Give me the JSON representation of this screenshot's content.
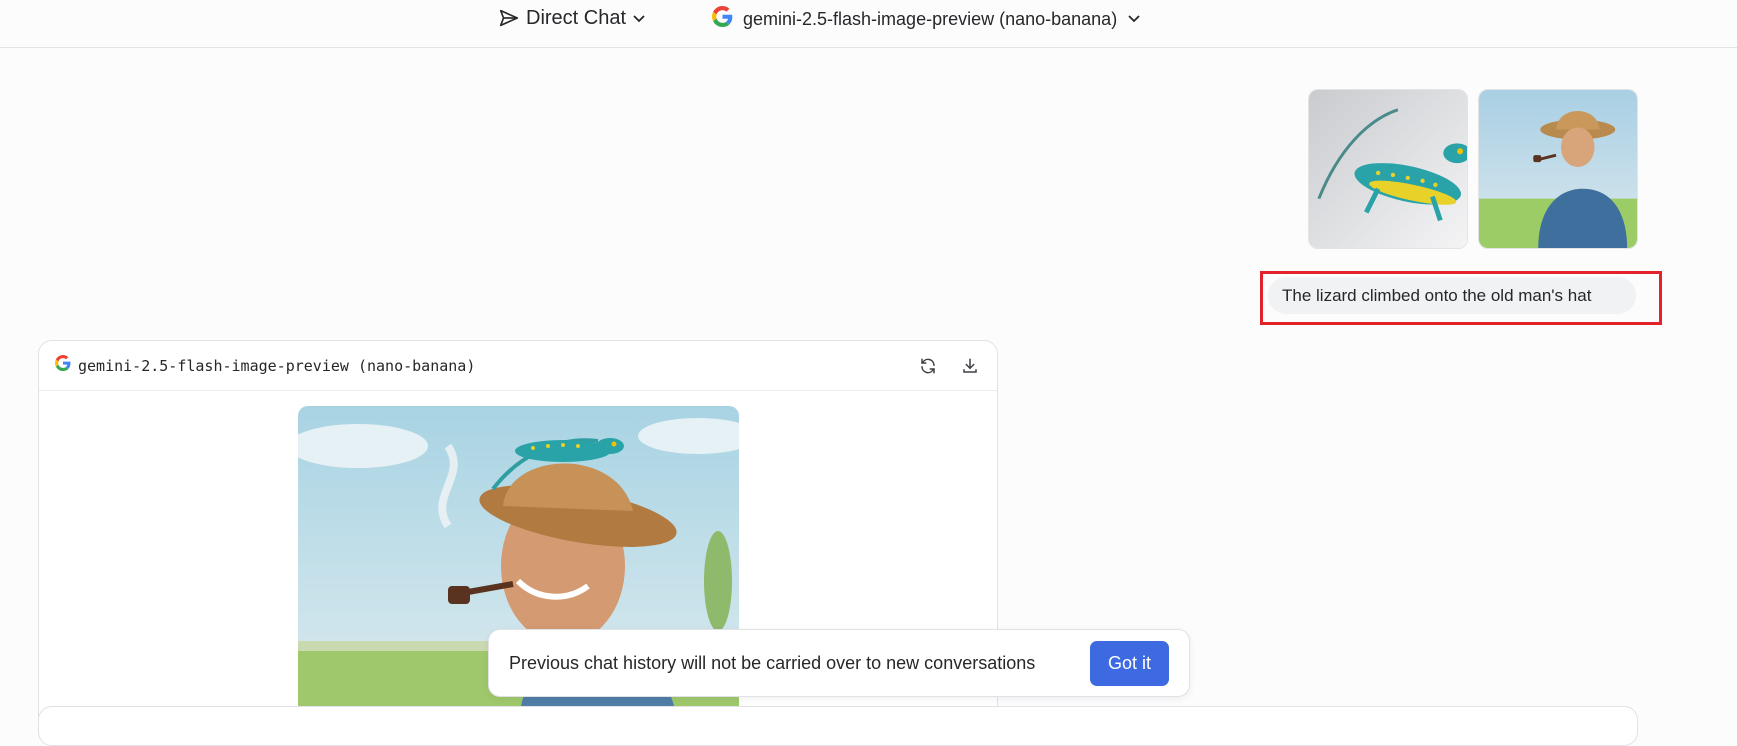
{
  "header": {
    "mode_label": "Direct Chat",
    "model_label": "gemini-2.5-flash-image-preview (nano-banana)"
  },
  "user_message": {
    "attachments": [
      {
        "name": "lizard-image"
      },
      {
        "name": "old-man-image"
      }
    ],
    "text": "The lizard climbed onto the old man's hat"
  },
  "response": {
    "model_name": "gemini-2.5-flash-image-preview (nano-banana)",
    "actions": [
      "refresh-icon",
      "download-icon"
    ]
  },
  "toast": {
    "message": "Previous chat history will not be carried over to new conversations",
    "button_label": "Got it"
  },
  "colors": {
    "accent": "#3e6ae1",
    "highlight": "#e3222a"
  }
}
